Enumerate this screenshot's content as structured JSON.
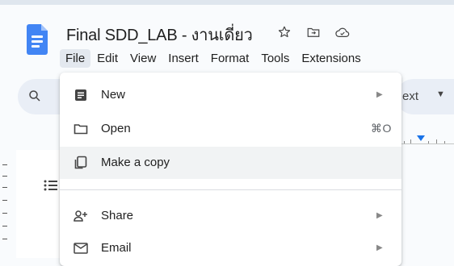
{
  "document": {
    "title": "Final SDD_LAB - งานเดี่ยว",
    "title_icons": [
      "star-icon",
      "move-to-folder-icon",
      "cloud-saved-icon"
    ]
  },
  "menubar": {
    "items": [
      "File",
      "Edit",
      "View",
      "Insert",
      "Format",
      "Tools",
      "Extensions"
    ],
    "active": "File"
  },
  "toolbar": {
    "search_icon": "search-icon",
    "style_text": "ext"
  },
  "file_menu": {
    "items": [
      {
        "label": "New",
        "icon": "document-icon",
        "submenu": true
      },
      {
        "label": "Open",
        "icon": "folder-icon",
        "shortcut": "⌘O"
      },
      {
        "label": "Make a copy",
        "icon": "copy-icon",
        "highlighted": true
      },
      {
        "label": "Share",
        "icon": "share-person-icon",
        "submenu": true
      },
      {
        "label": "Email",
        "icon": "email-icon",
        "submenu": true
      }
    ]
  },
  "colors": {
    "brand_blue": "#4285f4",
    "background": "#f9fbfd",
    "menu_hover": "#f1f3f4",
    "active_menu_bg": "#e3e8ef",
    "ruler_marker": "#1a73e8"
  }
}
